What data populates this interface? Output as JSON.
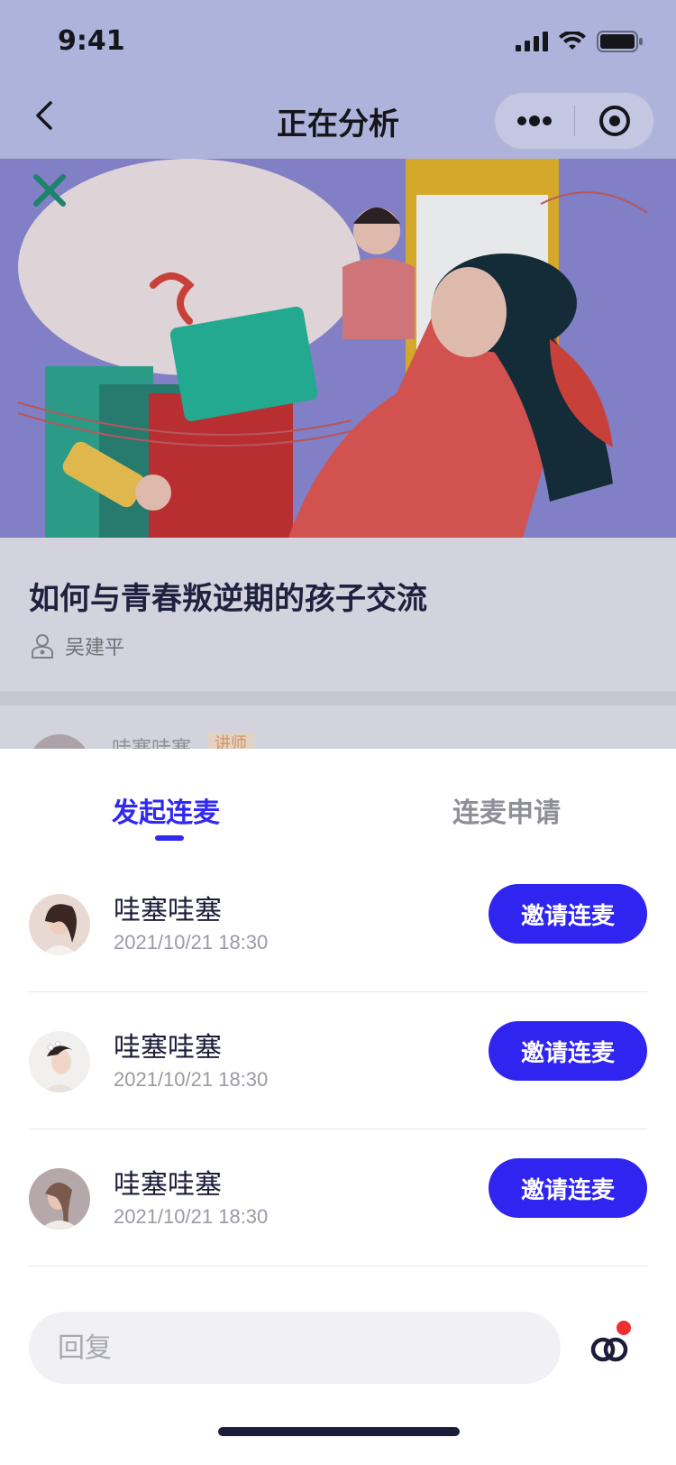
{
  "status_bar": {
    "time": "9:41"
  },
  "nav": {
    "title": "正在分析"
  },
  "course": {
    "title": "如何与青春叛逆期的孩子交流",
    "author": "吴建平"
  },
  "peek_row": {
    "name": "哇塞哇塞",
    "badge": "讲师"
  },
  "sheet": {
    "tabs": [
      {
        "label": "发起连麦",
        "active": true
      },
      {
        "label": "连麦申请",
        "active": false
      }
    ],
    "rows": [
      {
        "name": "哇塞哇塞",
        "time": "2021/10/21 18:30",
        "button": "邀请连麦"
      },
      {
        "name": "哇塞哇塞",
        "time": "2021/10/21 18:30",
        "button": "邀请连麦"
      },
      {
        "name": "哇塞哇塞",
        "time": "2021/10/21 18:30",
        "button": "邀请连麦"
      }
    ],
    "reply_placeholder": "回复"
  },
  "colors": {
    "accent": "#2f24f0",
    "notification_dot": "#ef2f2f"
  }
}
